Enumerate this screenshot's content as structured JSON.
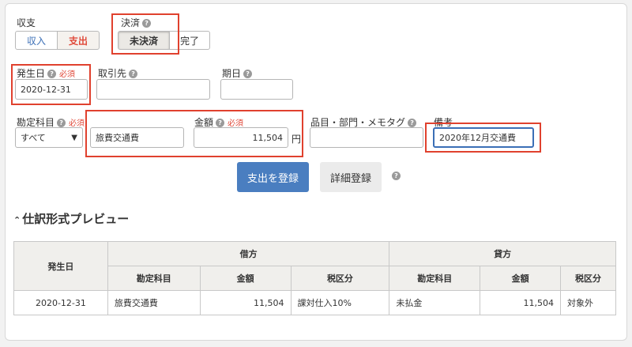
{
  "type_section": {
    "label": "収支",
    "options": [
      "収入",
      "支出"
    ],
    "selected": "支出"
  },
  "settlement": {
    "label": "決済",
    "options": [
      "未決済",
      "完了"
    ],
    "selected": "未決済"
  },
  "issue_date": {
    "label": "発生日",
    "required": "必須",
    "value": "2020-12-31"
  },
  "partner": {
    "label": "取引先",
    "value": ""
  },
  "due_date": {
    "label": "期日",
    "value": ""
  },
  "account": {
    "label": "勘定科目",
    "required": "必須",
    "selected": "すべて",
    "value": "旅費交通費"
  },
  "amount": {
    "label": "金額",
    "required": "必須",
    "value": "11,504",
    "unit": "円"
  },
  "tags": {
    "label": "品目・部門・メモタグ",
    "value": ""
  },
  "remarks": {
    "label": "備考",
    "value": "2020年12月交通費"
  },
  "buttons": {
    "register": "支出を登録",
    "detail": "詳細登録"
  },
  "preview": {
    "title": "仕訳形式プレビュー",
    "col_date": "発生日",
    "debit": "借方",
    "credit": "貸方",
    "sub_headers": [
      "勘定科目",
      "金額",
      "税区分",
      "勘定科目",
      "金額",
      "税区分"
    ],
    "row": {
      "date": "2020-12-31",
      "debit_account": "旅費交通費",
      "debit_amount": "11,504",
      "debit_tax": "課対仕入10%",
      "credit_account": "未払金",
      "credit_amount": "11,504",
      "credit_tax": "対象外"
    }
  },
  "colors": {
    "accent_red": "#e0412e",
    "primary_blue": "#4a7ec0",
    "income_blue": "#3b6fb6",
    "expense_red": "#e04a3a"
  }
}
